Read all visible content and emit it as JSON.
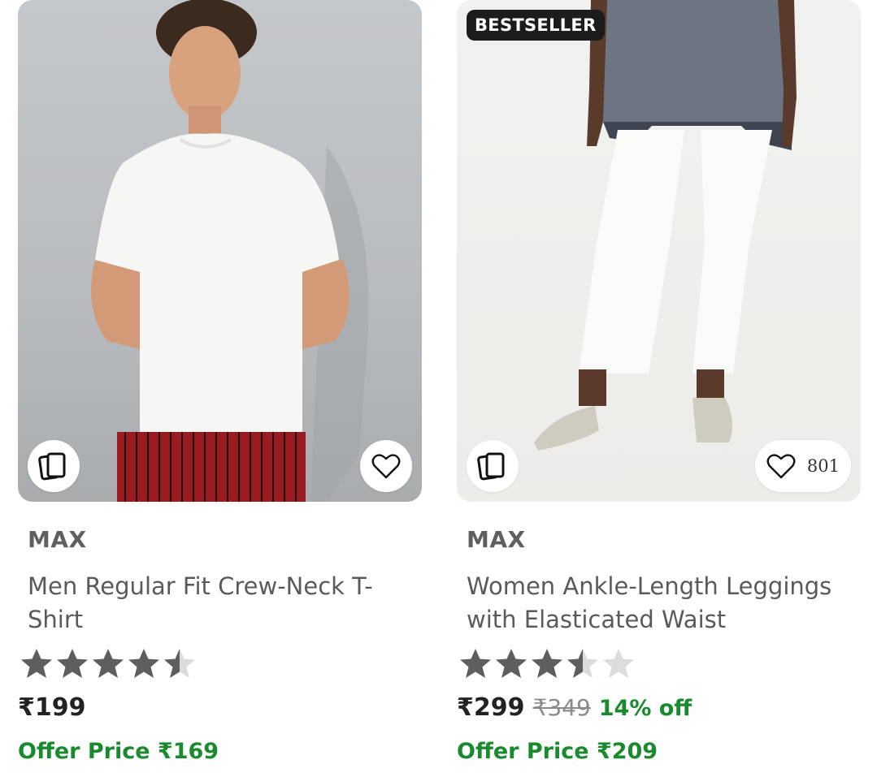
{
  "products": [
    {
      "brand": "MAX",
      "title": "Men Regular Fit Crew-Neck T-Shirt",
      "rating": 4.5,
      "price": "₹199",
      "offer_label": "Offer Price",
      "offer_price": "₹169",
      "icons": {
        "similar": "similar-cards-icon",
        "wishlist": "heart-outline-icon"
      }
    },
    {
      "badge": "BESTSELLER",
      "brand": "MAX",
      "title": "Women Ankle-Length Leggings with Elasticated Waist",
      "rating": 3.5,
      "price": "₹299",
      "mrp": "₹349",
      "discount": "14% off",
      "offer_label": "Offer Price",
      "offer_price": "₹209",
      "wishlist_count": "801",
      "icons": {
        "similar": "similar-cards-icon",
        "wishlist": "heart-outline-icon"
      }
    }
  ],
  "colors": {
    "offer_green": "#1a8a2e",
    "star_filled": "#5e5e5e",
    "star_empty": "#dcdcdc",
    "badge_bg": "#1c1c1c"
  }
}
